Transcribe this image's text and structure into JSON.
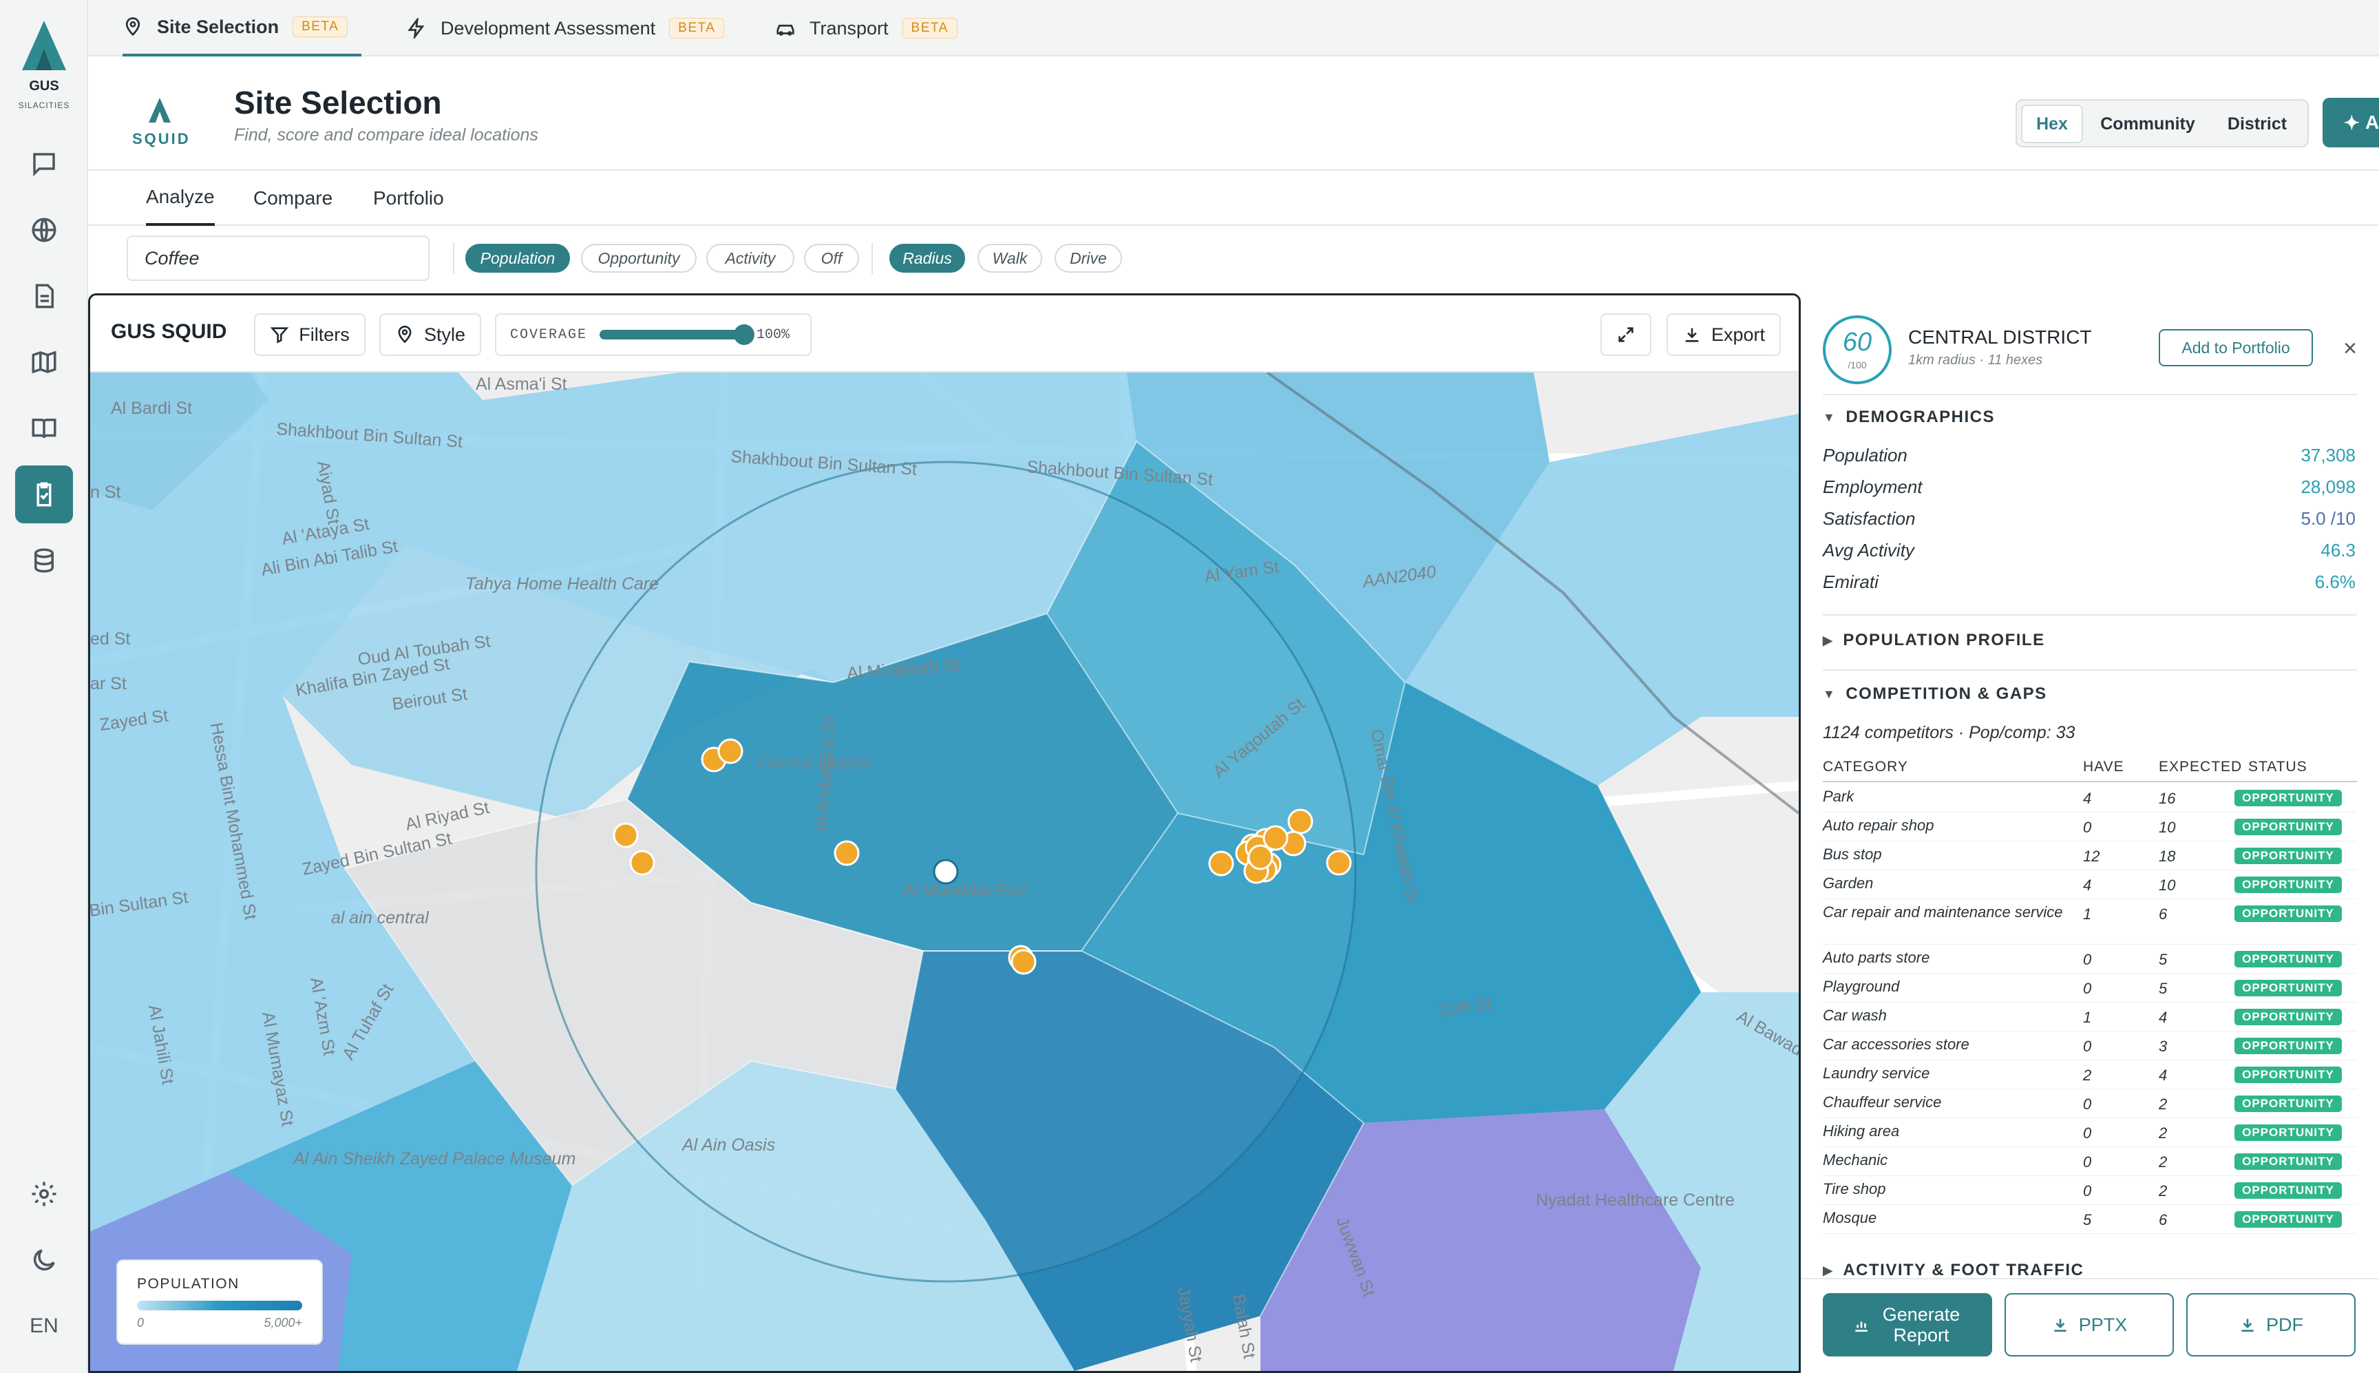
{
  "brand": {
    "logo_line1": "GUS",
    "logo_line2": "SILACITIES",
    "product": "SQUID"
  },
  "rail": {
    "language": "EN"
  },
  "top_tabs": [
    {
      "label": "Site Selection",
      "badge": "BETA"
    },
    {
      "label": "Development Assessment",
      "badge": "BETA"
    },
    {
      "label": "Transport",
      "badge": "BETA"
    }
  ],
  "header": {
    "title": "Site Selection",
    "subtitle": "Find, score and compare ideal locations",
    "views": [
      "Hex",
      "Community",
      "District"
    ],
    "ask_label": "Ask"
  },
  "sub_tabs": [
    "Analyze",
    "Compare",
    "Portfolio"
  ],
  "filters": {
    "search_value": "Coffee",
    "layer_chips": [
      "Population",
      "Opportunity",
      "Activity",
      "Off"
    ],
    "mode_chips": [
      "Radius",
      "Walk",
      "Drive"
    ]
  },
  "map_toolbar": {
    "title": "GUS SQUID",
    "filters_label": "Filters",
    "style_label": "Style",
    "coverage_label": "COVERAGE",
    "coverage_value": "100%",
    "coverage_fraction": 1.0,
    "export_label": "Export"
  },
  "map_labels": {
    "streets": [
      "Al Asma'i St",
      "Al Bardi St",
      "Shakhbout Bin Sultan St",
      "Shakhbout Bin Sultan St",
      "Shakhbout Bin Sultan St",
      "Aiyad St",
      "Al 'Ataya St",
      "Ali Bin Abi Talib St",
      "Tahya Home Health Care",
      "Oud Al Toubah St",
      "Khalifa Bin Zayed St",
      "Beirout St",
      "Zayed St",
      "Hessa Bint Mohammed St",
      "Al Riyad St",
      "Zayed Bin Sultan St",
      "al ain central",
      "Bin Sultan St",
      "Al Jahili St",
      "Al 'Azm St",
      "Al Mumayaz St",
      "Al Tuhaf St",
      "Al Ain Sheikh Zayed Palace Museum",
      "Al Ain Oasis",
      "Al Mirabbah St",
      "Central District",
      "Al Andalousi St",
      "Al Murabba Fort",
      "Al Yaqoutah St",
      "Omar Bin Al Khattab St",
      "Al Yam St",
      "AAN2040",
      "Al Bawadi",
      "11th St",
      "Nyadat Healthcare Centre",
      "Jayyah St",
      "Balah St",
      "Juwwan St",
      "ed St",
      "ar St",
      "n St"
    ],
    "legend_title": "POPULATION",
    "legend_min": "0",
    "legend_max": "5,000+"
  },
  "side_panel": {
    "score": "60",
    "score_max": "/100",
    "district": "CENTRAL DISTRICT",
    "district_meta": "1km radius · 11 hexes",
    "add_portfolio": "Add to Portfolio",
    "demographics_title": "DEMOGRAPHICS",
    "demographics": [
      {
        "label": "Population",
        "value": "37,308",
        "color": "#2aa0b5"
      },
      {
        "label": "Employment",
        "value": "28,098",
        "color": "#2aa0b5"
      },
      {
        "label": "Satisfaction",
        "value": "5.0 /10",
        "color": "#4f6fb0"
      },
      {
        "label": "Avg Activity",
        "value": "46.3",
        "color": "#2aa0b5"
      },
      {
        "label": "Emirati",
        "value": "6.6%",
        "color": "#2aa0b5"
      }
    ],
    "population_profile_title": "POPULATION PROFILE",
    "competition_title": "COMPETITION & GAPS",
    "competition_summary": "1124 competitors · Pop/comp: 33",
    "table_headers": [
      "CATEGORY",
      "HAVE",
      "EXPECTED",
      "STATUS"
    ],
    "rows": [
      {
        "category": "Park",
        "have": "4",
        "expected": "16",
        "status": "OPPORTUNITY"
      },
      {
        "category": "Auto repair shop",
        "have": "0",
        "expected": "10",
        "status": "OPPORTUNITY"
      },
      {
        "category": "Bus stop",
        "have": "12",
        "expected": "18",
        "status": "OPPORTUNITY"
      },
      {
        "category": "Garden",
        "have": "4",
        "expected": "10",
        "status": "OPPORTUNITY"
      },
      {
        "category": "Car repair and maintenance service",
        "have": "1",
        "expected": "6",
        "status": "OPPORTUNITY"
      },
      {
        "category": "Auto parts store",
        "have": "0",
        "expected": "5",
        "status": "OPPORTUNITY"
      },
      {
        "category": "Playground",
        "have": "0",
        "expected": "5",
        "status": "OPPORTUNITY"
      },
      {
        "category": "Car wash",
        "have": "1",
        "expected": "4",
        "status": "OPPORTUNITY"
      },
      {
        "category": "Car accessories store",
        "have": "0",
        "expected": "3",
        "status": "OPPORTUNITY"
      },
      {
        "category": "Laundry service",
        "have": "2",
        "expected": "4",
        "status": "OPPORTUNITY"
      },
      {
        "category": "Chauffeur service",
        "have": "0",
        "expected": "2",
        "status": "OPPORTUNITY"
      },
      {
        "category": "Hiking area",
        "have": "0",
        "expected": "2",
        "status": "OPPORTUNITY"
      },
      {
        "category": "Mechanic",
        "have": "0",
        "expected": "2",
        "status": "OPPORTUNITY"
      },
      {
        "category": "Tire shop",
        "have": "0",
        "expected": "2",
        "status": "OPPORTUNITY"
      },
      {
        "category": "Mosque",
        "have": "5",
        "expected": "6",
        "status": "OPPORTUNITY"
      }
    ],
    "next_section": "ACTIVITY & FOOT TRAFFIC",
    "generate_label": "Generate Report",
    "pptx_label": "PPTX",
    "pdf_label": "PDF"
  }
}
